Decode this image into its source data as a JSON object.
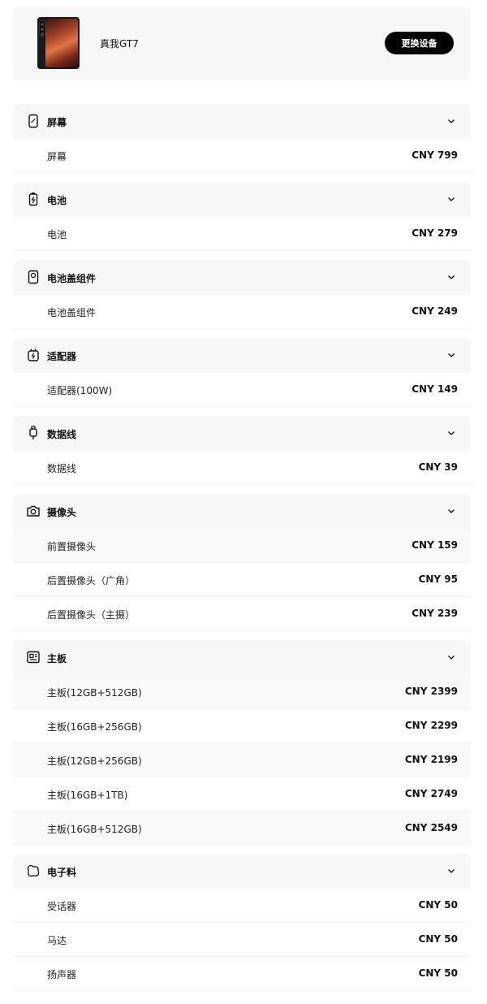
{
  "device": {
    "name": "真我GT7",
    "switch_label": "更换设备"
  },
  "categories": [
    {
      "title": "屏幕",
      "icon": "phone-screen-icon",
      "items": [
        {
          "label": "屏幕",
          "price": "CNY 799"
        }
      ]
    },
    {
      "title": "电池",
      "icon": "battery-icon",
      "items": [
        {
          "label": "电池",
          "price": "CNY 279"
        }
      ]
    },
    {
      "title": "电池盖组件",
      "icon": "back-cover-icon",
      "items": [
        {
          "label": "电池盖组件",
          "price": "CNY 249"
        }
      ]
    },
    {
      "title": "适配器",
      "icon": "adapter-icon",
      "items": [
        {
          "label": "适配器(100W)",
          "price": "CNY 149"
        }
      ]
    },
    {
      "title": "数据线",
      "icon": "cable-icon",
      "items": [
        {
          "label": "数据线",
          "price": "CNY 39"
        }
      ]
    },
    {
      "title": "摄像头",
      "icon": "camera-icon",
      "items": [
        {
          "label": "前置摄像头",
          "price": "CNY 159"
        },
        {
          "label": "后置摄像头（广角）",
          "price": "CNY 95"
        },
        {
          "label": "后置摄像头（主摄）",
          "price": "CNY 239"
        }
      ]
    },
    {
      "title": "主板",
      "icon": "motherboard-icon",
      "items": [
        {
          "label": "主板(12GB+512GB)",
          "price": "CNY 2399"
        },
        {
          "label": "主板(16GB+256GB)",
          "price": "CNY 2299"
        },
        {
          "label": "主板(12GB+256GB)",
          "price": "CNY 2199"
        },
        {
          "label": "主板(16GB+1TB)",
          "price": "CNY 2749"
        },
        {
          "label": "主板(16GB+512GB)",
          "price": "CNY 2549"
        }
      ]
    },
    {
      "title": "电子料",
      "icon": "electronic-parts-icon",
      "items": [
        {
          "label": "受话器",
          "price": "CNY 50"
        },
        {
          "label": "马达",
          "price": "CNY 50"
        },
        {
          "label": "扬声器",
          "price": "CNY 50"
        }
      ]
    }
  ]
}
